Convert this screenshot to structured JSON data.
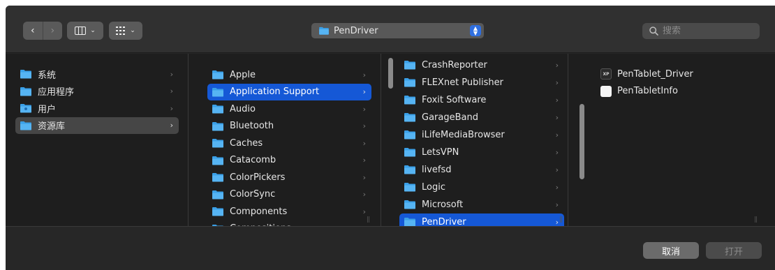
{
  "toolbar": {
    "back_glyph": "‹",
    "forward_glyph": "›",
    "view_columns_icon": "columns-view-icon",
    "view_groups_icon": "group-icon",
    "path_label": "PenDriver",
    "search_placeholder": "搜索"
  },
  "columns": [
    {
      "items": [
        {
          "label": "系统",
          "kind": "folder",
          "has_children": true
        },
        {
          "label": "应用程序",
          "kind": "folder",
          "has_children": true
        },
        {
          "label": "用户",
          "kind": "folder-user",
          "has_children": true
        },
        {
          "label": "资源库",
          "kind": "folder",
          "has_children": true,
          "state": "selected-gray"
        }
      ]
    },
    {
      "items": [
        {
          "label": "Apple",
          "kind": "folder",
          "has_children": true
        },
        {
          "label": "Application Support",
          "kind": "folder",
          "has_children": true,
          "state": "selected-blue"
        },
        {
          "label": "Audio",
          "kind": "folder",
          "has_children": true
        },
        {
          "label": "Bluetooth",
          "kind": "folder",
          "has_children": true
        },
        {
          "label": "Caches",
          "kind": "folder",
          "has_children": true
        },
        {
          "label": "Catacomb",
          "kind": "folder",
          "has_children": true
        },
        {
          "label": "ColorPickers",
          "kind": "folder",
          "has_children": true
        },
        {
          "label": "ColorSync",
          "kind": "folder",
          "has_children": true
        },
        {
          "label": "Components",
          "kind": "folder",
          "has_children": true
        },
        {
          "label": "Compositions",
          "kind": "folder",
          "has_children": true
        }
      ]
    },
    {
      "items": [
        {
          "label": "CrashReporter",
          "kind": "folder",
          "has_children": true
        },
        {
          "label": "FLEXnet Publisher",
          "kind": "folder",
          "has_children": true
        },
        {
          "label": "Foxit Software",
          "kind": "folder",
          "has_children": true
        },
        {
          "label": "GarageBand",
          "kind": "folder",
          "has_children": true
        },
        {
          "label": "iLifeMediaBrowser",
          "kind": "folder",
          "has_children": true
        },
        {
          "label": "LetsVPN",
          "kind": "folder",
          "has_children": true
        },
        {
          "label": "livefsd",
          "kind": "folder",
          "has_children": true
        },
        {
          "label": "Logic",
          "kind": "folder",
          "has_children": true
        },
        {
          "label": "Microsoft",
          "kind": "folder",
          "has_children": true
        },
        {
          "label": "PenDriver",
          "kind": "folder",
          "has_children": true,
          "state": "selected-blue"
        }
      ]
    },
    {
      "items": [
        {
          "label": "PenTablet_Driver",
          "kind": "xp-app",
          "has_children": false
        },
        {
          "label": "PenTabletInfo",
          "kind": "document",
          "has_children": false
        }
      ]
    }
  ],
  "footer": {
    "cancel_label": "取消",
    "open_label": "打开"
  },
  "colors": {
    "selection_blue": "#1558d6",
    "folder_blue": "#3aa0e8"
  }
}
